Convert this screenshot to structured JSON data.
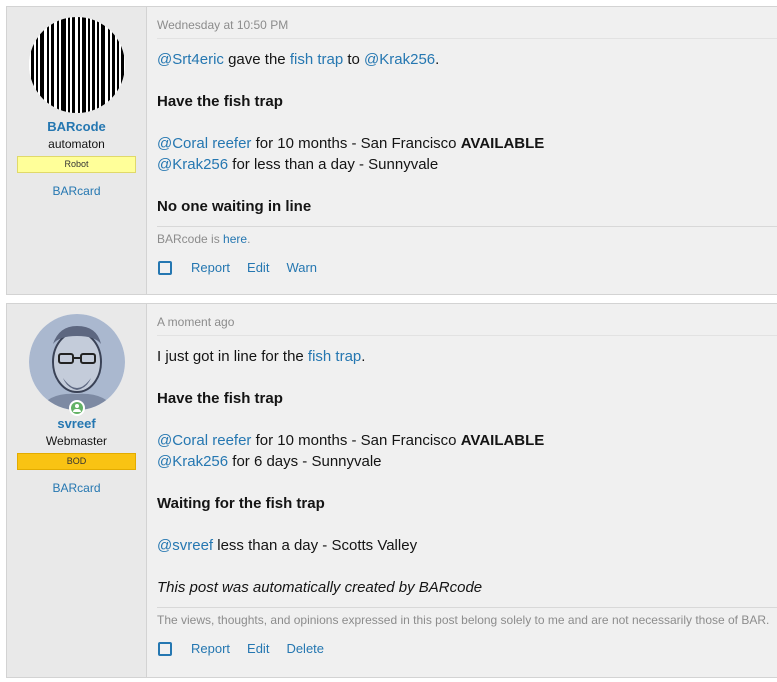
{
  "posts": [
    {
      "user": {
        "name": "BARcode",
        "title": "automaton",
        "banner": "Robot",
        "card": "BARcard",
        "avatar_icon": "barcode-avatar-icon"
      },
      "date": "Wednesday at 10:50 PM",
      "line1": {
        "from": "@Srt4eric",
        "verb": " gave the ",
        "item": "fish trap",
        "to": " to ",
        "recipient": "@Krak256",
        "end": "."
      },
      "heading1": "Have the fish trap",
      "holders": [
        {
          "user": "@Coral reefer",
          "text": " for 10 months - San Francisco ",
          "flag": "AVAILABLE"
        },
        {
          "user": "@Krak256",
          "text": " for less than a day - Sunnyvale",
          "flag": ""
        }
      ],
      "heading2": "No one waiting in line",
      "signature": {
        "prefix": "BARcode is ",
        "link": "here",
        "suffix": "."
      },
      "actions": {
        "report": "Report",
        "edit": "Edit",
        "third": "Warn"
      }
    },
    {
      "user": {
        "name": "svreef",
        "title": "Webmaster",
        "banner": "BOD",
        "card": "BARcard",
        "avatar_icon": "portrait-avatar-icon"
      },
      "date": "A moment ago",
      "line1": {
        "prefix": "I just got in line for the ",
        "item": "fish trap",
        "end": "."
      },
      "heading1": "Have the fish trap",
      "holders": [
        {
          "user": "@Coral reefer",
          "text": " for 10 months - San Francisco ",
          "flag": "AVAILABLE"
        },
        {
          "user": "@Krak256",
          "text": " for 6 days - Sunnyvale",
          "flag": ""
        }
      ],
      "heading2": "Waiting for the fish trap",
      "waiting": {
        "user": "@svreef",
        "text": " less than a day - Scotts Valley"
      },
      "auto_note": "This post was automatically created by BARcode",
      "signature": {
        "text": "The views, thoughts, and opinions expressed in this post belong solely to me and are not necessarily those of BAR."
      },
      "actions": {
        "report": "Report",
        "edit": "Edit",
        "third": "Delete"
      }
    }
  ],
  "colors": {
    "link": "#2577b1",
    "robot_banner": "#ffff99",
    "bod_banner": "#f9c313",
    "online": "#63b265"
  }
}
